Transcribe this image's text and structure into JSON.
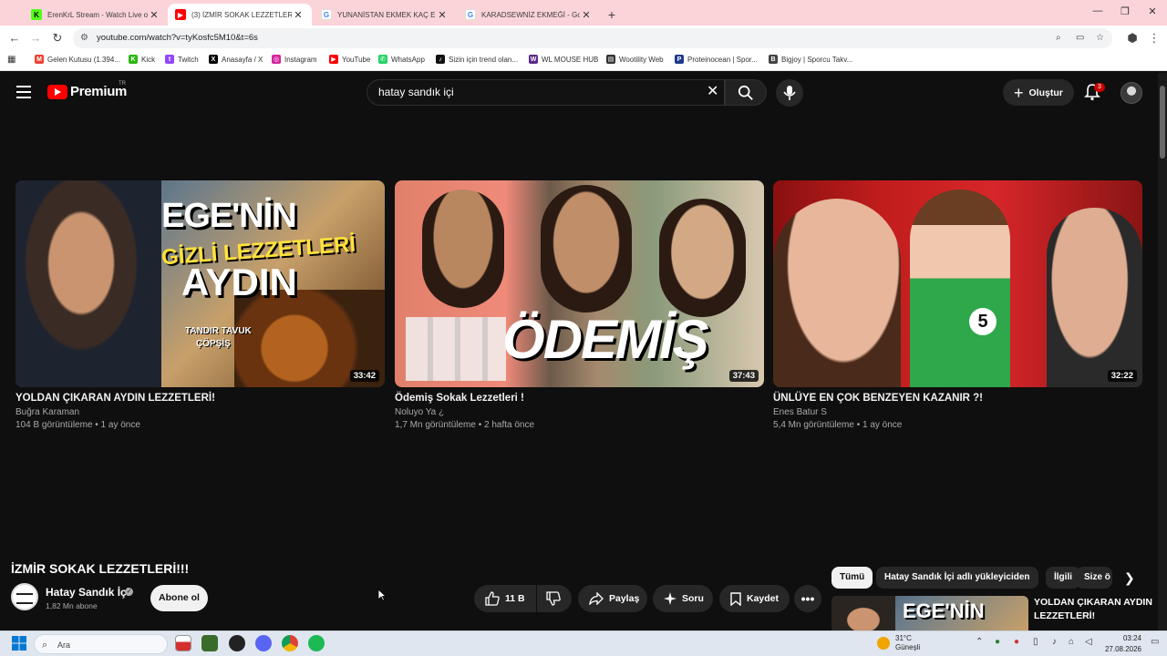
{
  "browser": {
    "tabs": [
      {
        "title": "ErenKrL Stream - Watch Live on Kick",
        "favicon": "kick-icon",
        "color": "#53fc18",
        "active": false
      },
      {
        "title": "(3) İZMİR SOKAK LEZZETLERİ!!!",
        "favicon": "youtube-icon",
        "color": "#ff0000",
        "active": true
      },
      {
        "title": "YUNANİSTAN EKMEK KAÇ EURO",
        "favicon": "google-icon",
        "color": "#4285f4",
        "active": false
      },
      {
        "title": "KARADSEWNİZ EKMEĞİ - Google",
        "favicon": "google-icon",
        "color": "#4285f4",
        "active": false
      }
    ],
    "url": "youtube.com/watch?v=tyKosfc5M10&t=6s",
    "bookmarks": [
      {
        "label": "Gelen Kutusu (1.394...",
        "icon": "gmail-icon",
        "color": "#ea4335"
      },
      {
        "label": "Kick",
        "icon": "kick-icon",
        "color": "#2bb812"
      },
      {
        "label": "Twitch",
        "icon": "twitch-icon",
        "color": "#9146ff"
      },
      {
        "label": "Anasayfa / X",
        "icon": "x-icon",
        "color": "#000000"
      },
      {
        "label": "Instagram",
        "icon": "instagram-icon",
        "color": "#d6249f"
      },
      {
        "label": "YouTube",
        "icon": "youtube-icon",
        "color": "#ff0000"
      },
      {
        "label": "WhatsApp",
        "icon": "whatsapp-icon",
        "color": "#25d366"
      },
      {
        "label": "Sizin için trend olan...",
        "icon": "tiktok-icon",
        "color": "#111111"
      },
      {
        "label": "WL MOUSE HUB",
        "icon": "wl-mouse-icon",
        "color": "#5b2a86"
      },
      {
        "label": "Wootility Web",
        "icon": "wootility-icon",
        "color": "#333333"
      },
      {
        "label": "Proteinocean | Spor...",
        "icon": "proteinocean-icon",
        "color": "#1e3a8a"
      },
      {
        "label": "Bigjoy | Sporcu Takv...",
        "icon": "bigjoy-icon",
        "color": "#444444"
      }
    ]
  },
  "youtube": {
    "logo_text": "Premium",
    "region_code": "TR",
    "search_query": "hatay sandık içi",
    "create_label": "Oluştur",
    "notification_count": "3",
    "videos": [
      {
        "title": "YOLDAN ÇIKARAN AYDIN LEZZETLERİ!",
        "channel": "Buğra Karaman",
        "meta": "104 B görüntüleme • 1 ay önce",
        "duration": "33:42",
        "thumb_text": [
          "EGE'NİN",
          "GİZLİ LEZZETLERİ",
          "AYDIN"
        ],
        "thumb_sub": [
          "TANDIR TAVUK",
          "ÇÖPŞİŞ"
        ]
      },
      {
        "title": "Ödemiş Sokak Lezzetleri !",
        "channel": "Noluyo Ya ¿",
        "meta": "1,7 Mn görüntüleme • 2 hafta önce",
        "duration": "37:43",
        "thumb_text": [
          "ÖDEMİŞ"
        ]
      },
      {
        "title": "ÜNLÜYE EN ÇOK BENZEYEN KAZANIR ?!",
        "channel": "Enes Batur S",
        "meta": "5,4 Mn görüntüleme • 1 ay önce",
        "duration": "32:22",
        "thumb_text": [
          "5"
        ]
      }
    ],
    "watch": {
      "title": "İZMİR SOKAK LEZZETLERİ!!!",
      "channel_name": "Hatay Sandık İçi",
      "subscribers": "1,82 Mn abone",
      "subscribe_label": "Abone ol",
      "like_count": "11 B",
      "share_label": "Paylaş",
      "ask_label": "Soru",
      "save_label": "Kaydet"
    },
    "chips": [
      {
        "label": "Tümü",
        "selected": true
      },
      {
        "label": "Hatay Sandık İçi adlı yükleyiciden",
        "selected": false
      },
      {
        "label": "İlgili",
        "selected": false
      },
      {
        "label": "Size ö",
        "selected": false
      }
    ],
    "up_next": {
      "title": "YOLDAN ÇIKARAN AYDIN LEZZETLERİ!",
      "thumb_text": "EGE'NİN"
    }
  },
  "taskbar": {
    "search_placeholder": "Ara",
    "weather_temp": "31°C",
    "weather_desc": "Güneşli",
    "time": "03:24",
    "date": "27.08.2026"
  }
}
